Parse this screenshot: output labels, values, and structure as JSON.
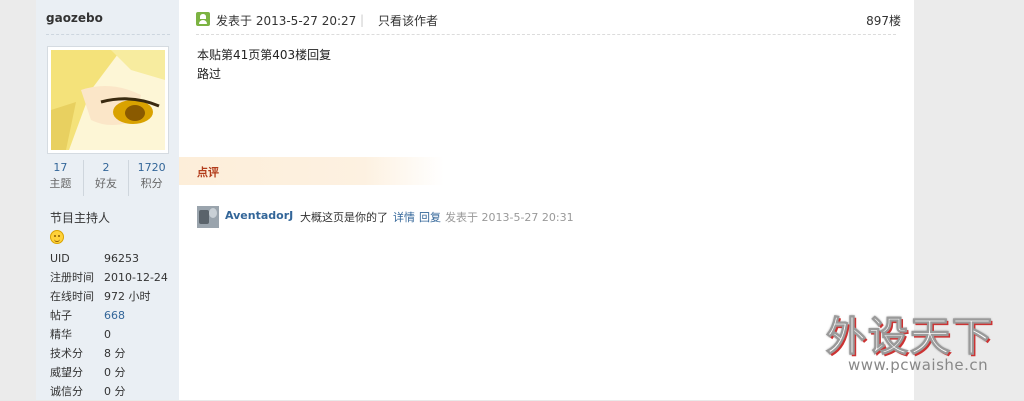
{
  "author": {
    "username": "gaozebo",
    "stats": [
      {
        "value": "17",
        "label": "主题"
      },
      {
        "value": "2",
        "label": "好友"
      },
      {
        "value": "1720",
        "label": "积分"
      }
    ],
    "rank_title": "节目主持人",
    "rank_icon": "smiley-icon",
    "info": [
      {
        "key": "UID",
        "value": "96253"
      },
      {
        "key": "注册时间",
        "value": "2010-12-24"
      },
      {
        "key": "在线时间",
        "value": "972 小时"
      },
      {
        "key": "帖子",
        "value": "668"
      },
      {
        "key": "精华",
        "value": "0"
      },
      {
        "key": "技术分",
        "value": "8 分"
      },
      {
        "key": "威望分",
        "value": "0 分"
      },
      {
        "key": "诚信分",
        "value": "0 分"
      }
    ]
  },
  "post": {
    "posted_at": "发表于 2013-5-27 20:27",
    "author_only": "只看该作者",
    "floor": "897楼",
    "body_lines": [
      "本贴第41页第403楼回复",
      "路过"
    ]
  },
  "comments": {
    "section_title": "点评",
    "items": [
      {
        "user": "AventadorJ",
        "text": "大概这页是你的了",
        "detail_link": "详情",
        "reply_link": "回复",
        "meta": "发表于 2013-5-27 20:31"
      }
    ]
  },
  "watermark": {
    "title": "外设天下",
    "url": "www.pcwaishe.cn"
  },
  "colors": {
    "link": "#336699",
    "sidebar_bg": "#eaeff4",
    "comment_bar": "#fdeed9",
    "comment_title": "#b23b1a"
  }
}
